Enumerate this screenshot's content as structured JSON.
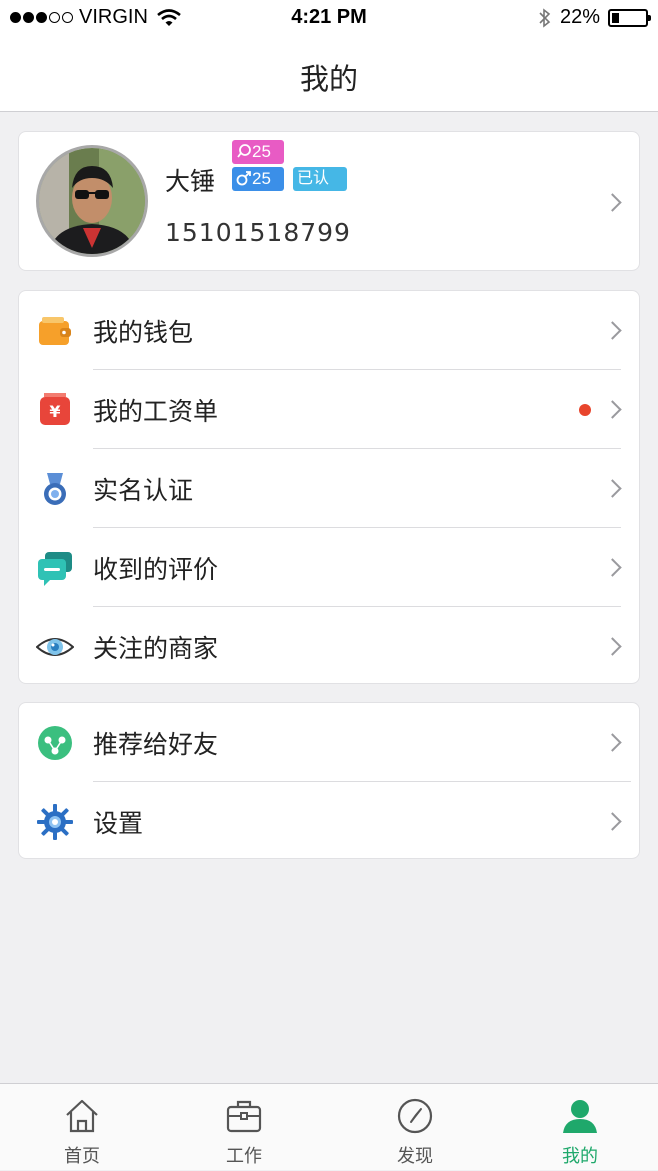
{
  "status_bar": {
    "carrier": "VIRGIN",
    "time": "4:21 PM",
    "battery": "22%",
    "battery_level": 0.22,
    "signal_bars_filled": 3,
    "signal_bars_total": 5,
    "icons": [
      "wifi-icon",
      "bluetooth-icon",
      "battery-icon"
    ]
  },
  "nav": {
    "title": "我的"
  },
  "profile": {
    "name": "大锤",
    "badge_comments": "25",
    "badge_gender_age": "25",
    "badge_verified": "已认证",
    "phone": "15101518799",
    "badge_colors": {
      "comments": "#e85bc4",
      "gender": "#3b8fe8",
      "verified": "#45b7e6"
    }
  },
  "menu_group_1": [
    {
      "label": "我的钱包",
      "icon": "wallet-icon",
      "dot": false
    },
    {
      "label": "我的工资单",
      "icon": "payslip-icon",
      "dot": true
    },
    {
      "label": "实名认证",
      "icon": "medal-icon",
      "dot": false
    },
    {
      "label": "收到的评价",
      "icon": "comments-icon",
      "dot": false
    },
    {
      "label": "关注的商家",
      "icon": "eye-icon",
      "dot": false
    }
  ],
  "menu_group_2": [
    {
      "label": "推荐给好友",
      "icon": "share-icon"
    },
    {
      "label": "设置",
      "icon": "gear-icon"
    }
  ],
  "tabbar": [
    {
      "label": "首页",
      "icon": "home-icon",
      "active": false
    },
    {
      "label": "工作",
      "icon": "briefcase-icon",
      "active": false
    },
    {
      "label": "发现",
      "icon": "compass-icon",
      "active": false
    },
    {
      "label": "我的",
      "icon": "person-icon",
      "active": true
    }
  ],
  "colors": {
    "accent": "#1fa86b",
    "notification_dot": "#e8452c",
    "background": "#f0f0f2"
  }
}
